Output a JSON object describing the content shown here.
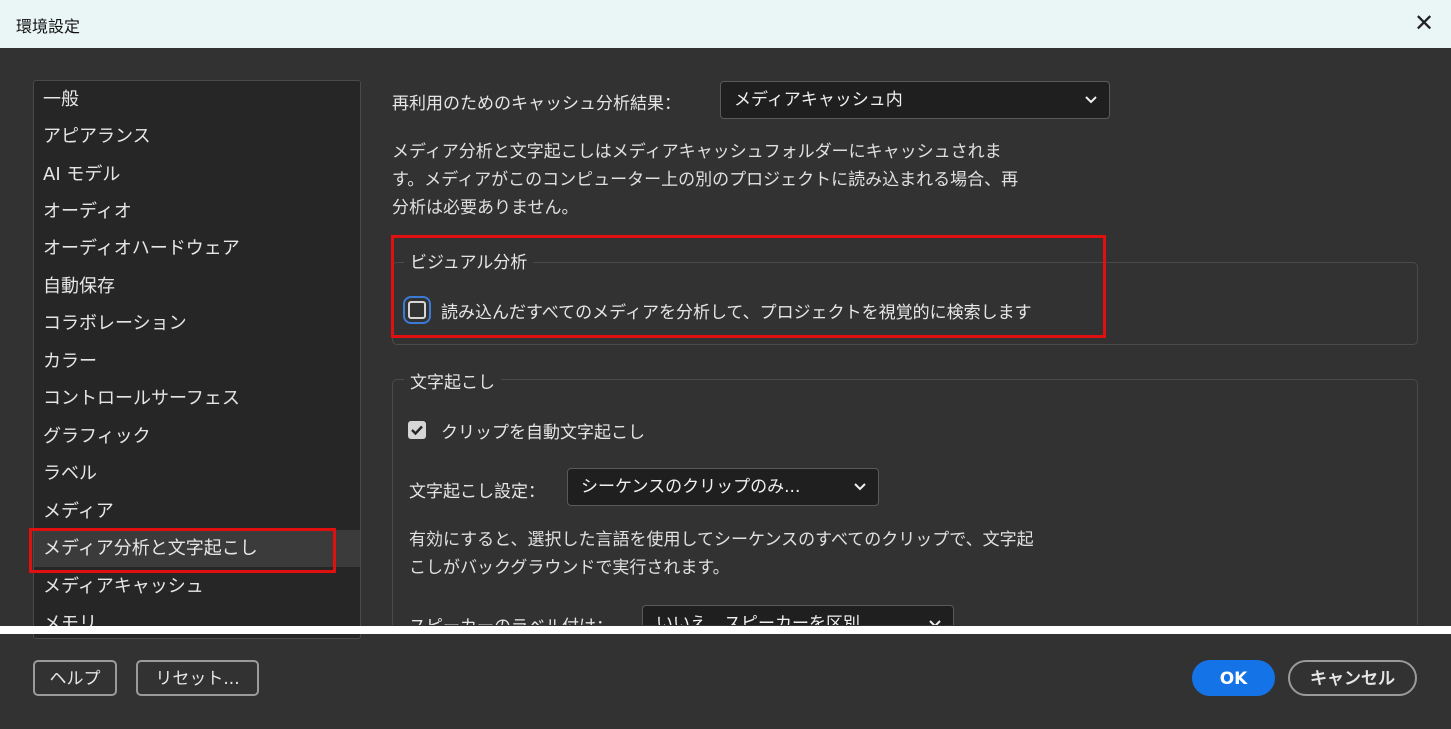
{
  "window": {
    "title": "環境設定"
  },
  "sidebar": {
    "items": [
      {
        "label": "一般"
      },
      {
        "label": "アピアランス"
      },
      {
        "label": "AI モデル"
      },
      {
        "label": "オーディオ"
      },
      {
        "label": "オーディオハードウェア"
      },
      {
        "label": "自動保存"
      },
      {
        "label": "コラボレーション"
      },
      {
        "label": "カラー"
      },
      {
        "label": "コントロールサーフェス"
      },
      {
        "label": "グラフィック"
      },
      {
        "label": "ラベル"
      },
      {
        "label": "メディア"
      },
      {
        "label": "メディア分析と文字起こし",
        "selected": true
      },
      {
        "label": "メディアキャッシュ"
      },
      {
        "label": "メモリ"
      }
    ]
  },
  "cache": {
    "label": "再利用のためのキャッシュ分析結果：",
    "value": "メディアキャッシュ内",
    "description_lines": [
      "メディア分析と文字起こしはメディアキャッシュフォルダーにキャッシュされま",
      "す。メディアがこのコンピューター上の別のプロジェクトに読み込まれる場合、再",
      "分析は必要ありません。"
    ]
  },
  "visual_analysis": {
    "title": "ビジュアル分析",
    "checkbox_label": "読み込んだすべてのメディアを分析して、プロジェクトを視覚的に検索します",
    "checked": false
  },
  "transcription": {
    "title": "文字起こし",
    "auto_label": "クリップを自動文字起こし",
    "auto_checked": true,
    "settings_label": "文字起こし設定：",
    "settings_value": "シーケンスのクリップのみ...",
    "description_lines": [
      "有効にすると、選択した言語を使用してシーケンスのすべてのクリップで、文字起",
      "こしがバックグラウンドで実行されます。"
    ],
    "speaker_label": "スピーカーのラベル付け：",
    "speaker_value": "いいえ、スピーカーを区別..."
  },
  "footer": {
    "help": "ヘルプ",
    "reset": "リセット...",
    "ok": "OK",
    "cancel": "キャンセル"
  },
  "colors": {
    "accent": "#1473e6",
    "highlight": "#e01010",
    "background": "#323232"
  }
}
